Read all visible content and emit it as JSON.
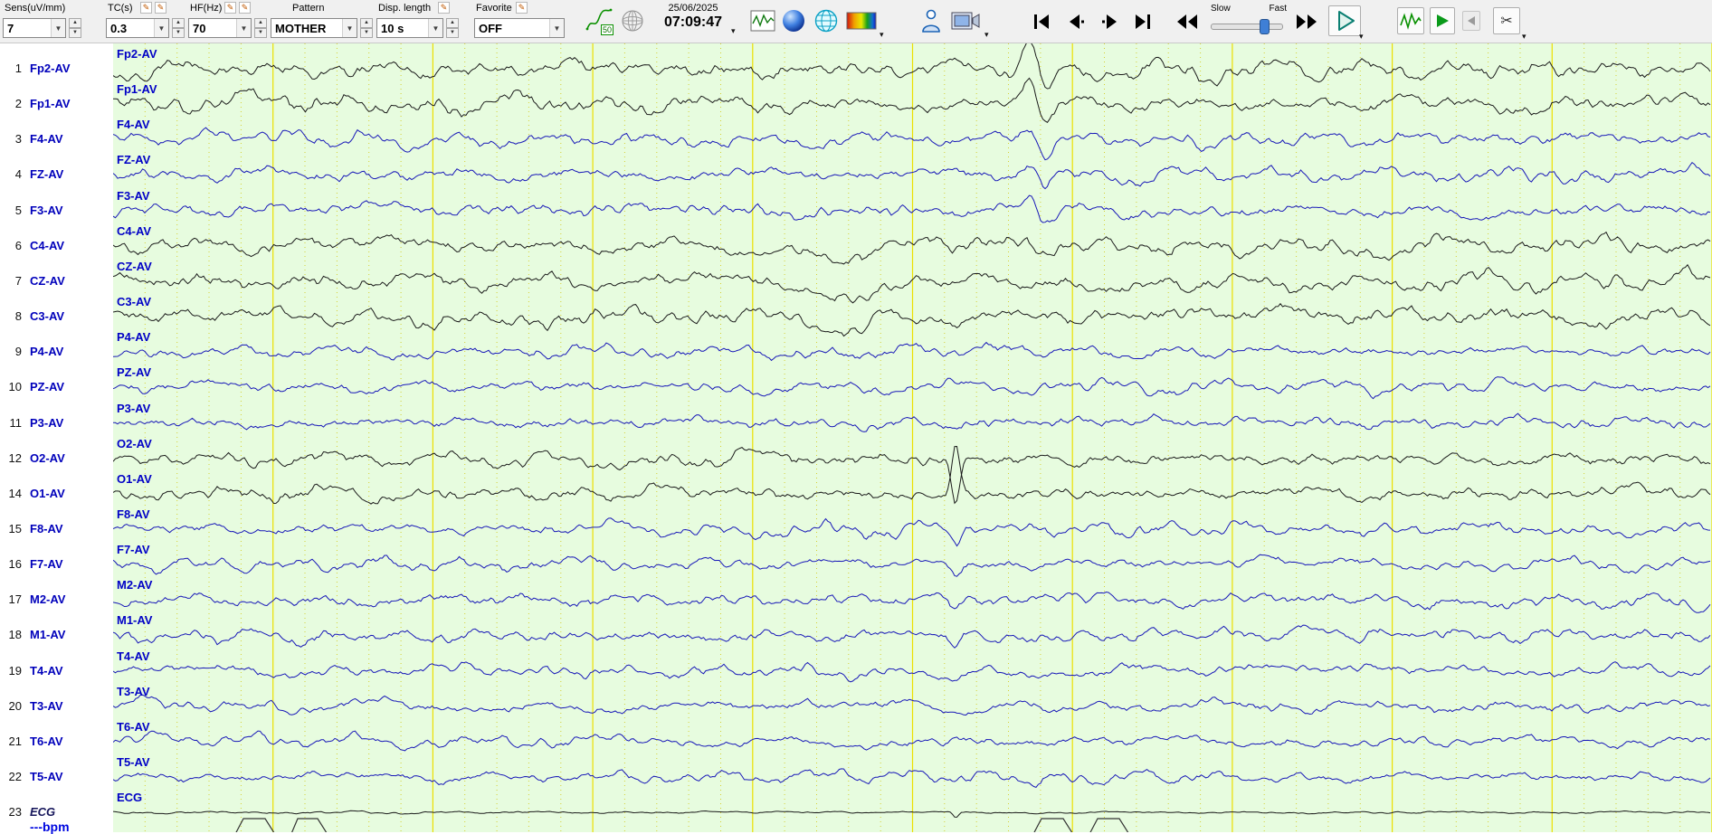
{
  "toolbar": {
    "sens_label": "Sens(uV/mm)",
    "sens_value": "7",
    "tc_label": "TC(s)",
    "tc_value": "0.3",
    "hf_label": "HF(Hz)",
    "hf_value": "70",
    "pattern_label": "Pattern",
    "pattern_value": "MOTHER",
    "disp_label": "Disp. length",
    "disp_value": "10 s",
    "favorite_label": "Favorite",
    "favorite_value": "OFF",
    "notch_value": "50",
    "date": "25/06/2025",
    "time": "07:09:47",
    "slow_label": "Slow",
    "fast_label": "Fast"
  },
  "channel_panel": {
    "bpm_label": "---bpm",
    "channels": [
      {
        "num": "1",
        "label": "Fp2-AV",
        "color": "black"
      },
      {
        "num": "2",
        "label": "Fp1-AV",
        "color": "black"
      },
      {
        "num": "3",
        "label": "F4-AV",
        "color": "blue"
      },
      {
        "num": "4",
        "label": "FZ-AV",
        "color": "blue"
      },
      {
        "num": "5",
        "label": "F3-AV",
        "color": "blue"
      },
      {
        "num": "6",
        "label": "C4-AV",
        "color": "black"
      },
      {
        "num": "7",
        "label": "CZ-AV",
        "color": "black"
      },
      {
        "num": "8",
        "label": "C3-AV",
        "color": "black"
      },
      {
        "num": "9",
        "label": "P4-AV",
        "color": "blue"
      },
      {
        "num": "10",
        "label": "PZ-AV",
        "color": "blue"
      },
      {
        "num": "11",
        "label": "P3-AV",
        "color": "blue"
      },
      {
        "num": "12",
        "label": "O2-AV",
        "color": "black"
      },
      {
        "num": "14",
        "label": "O1-AV",
        "color": "black"
      },
      {
        "num": "15",
        "label": "F8-AV",
        "color": "blue"
      },
      {
        "num": "16",
        "label": "F7-AV",
        "color": "blue"
      },
      {
        "num": "17",
        "label": "M2-AV",
        "color": "blue"
      },
      {
        "num": "18",
        "label": "M1-AV",
        "color": "blue"
      },
      {
        "num": "19",
        "label": "T4-AV",
        "color": "blue"
      },
      {
        "num": "20",
        "label": "T3-AV",
        "color": "blue"
      },
      {
        "num": "21",
        "label": "T6-AV",
        "color": "blue"
      },
      {
        "num": "22",
        "label": "T5-AV",
        "color": "blue"
      },
      {
        "num": "23",
        "label": "ECG",
        "color": "black",
        "italic": true
      }
    ]
  },
  "colors": {
    "bg_green": "#e7fcdf",
    "grid_major": "#ece000",
    "grid_minor": "#d6cf30",
    "trace_black": "#1b1b1b",
    "trace_blue": "#1818b8",
    "label_blue": "#0000c6"
  }
}
